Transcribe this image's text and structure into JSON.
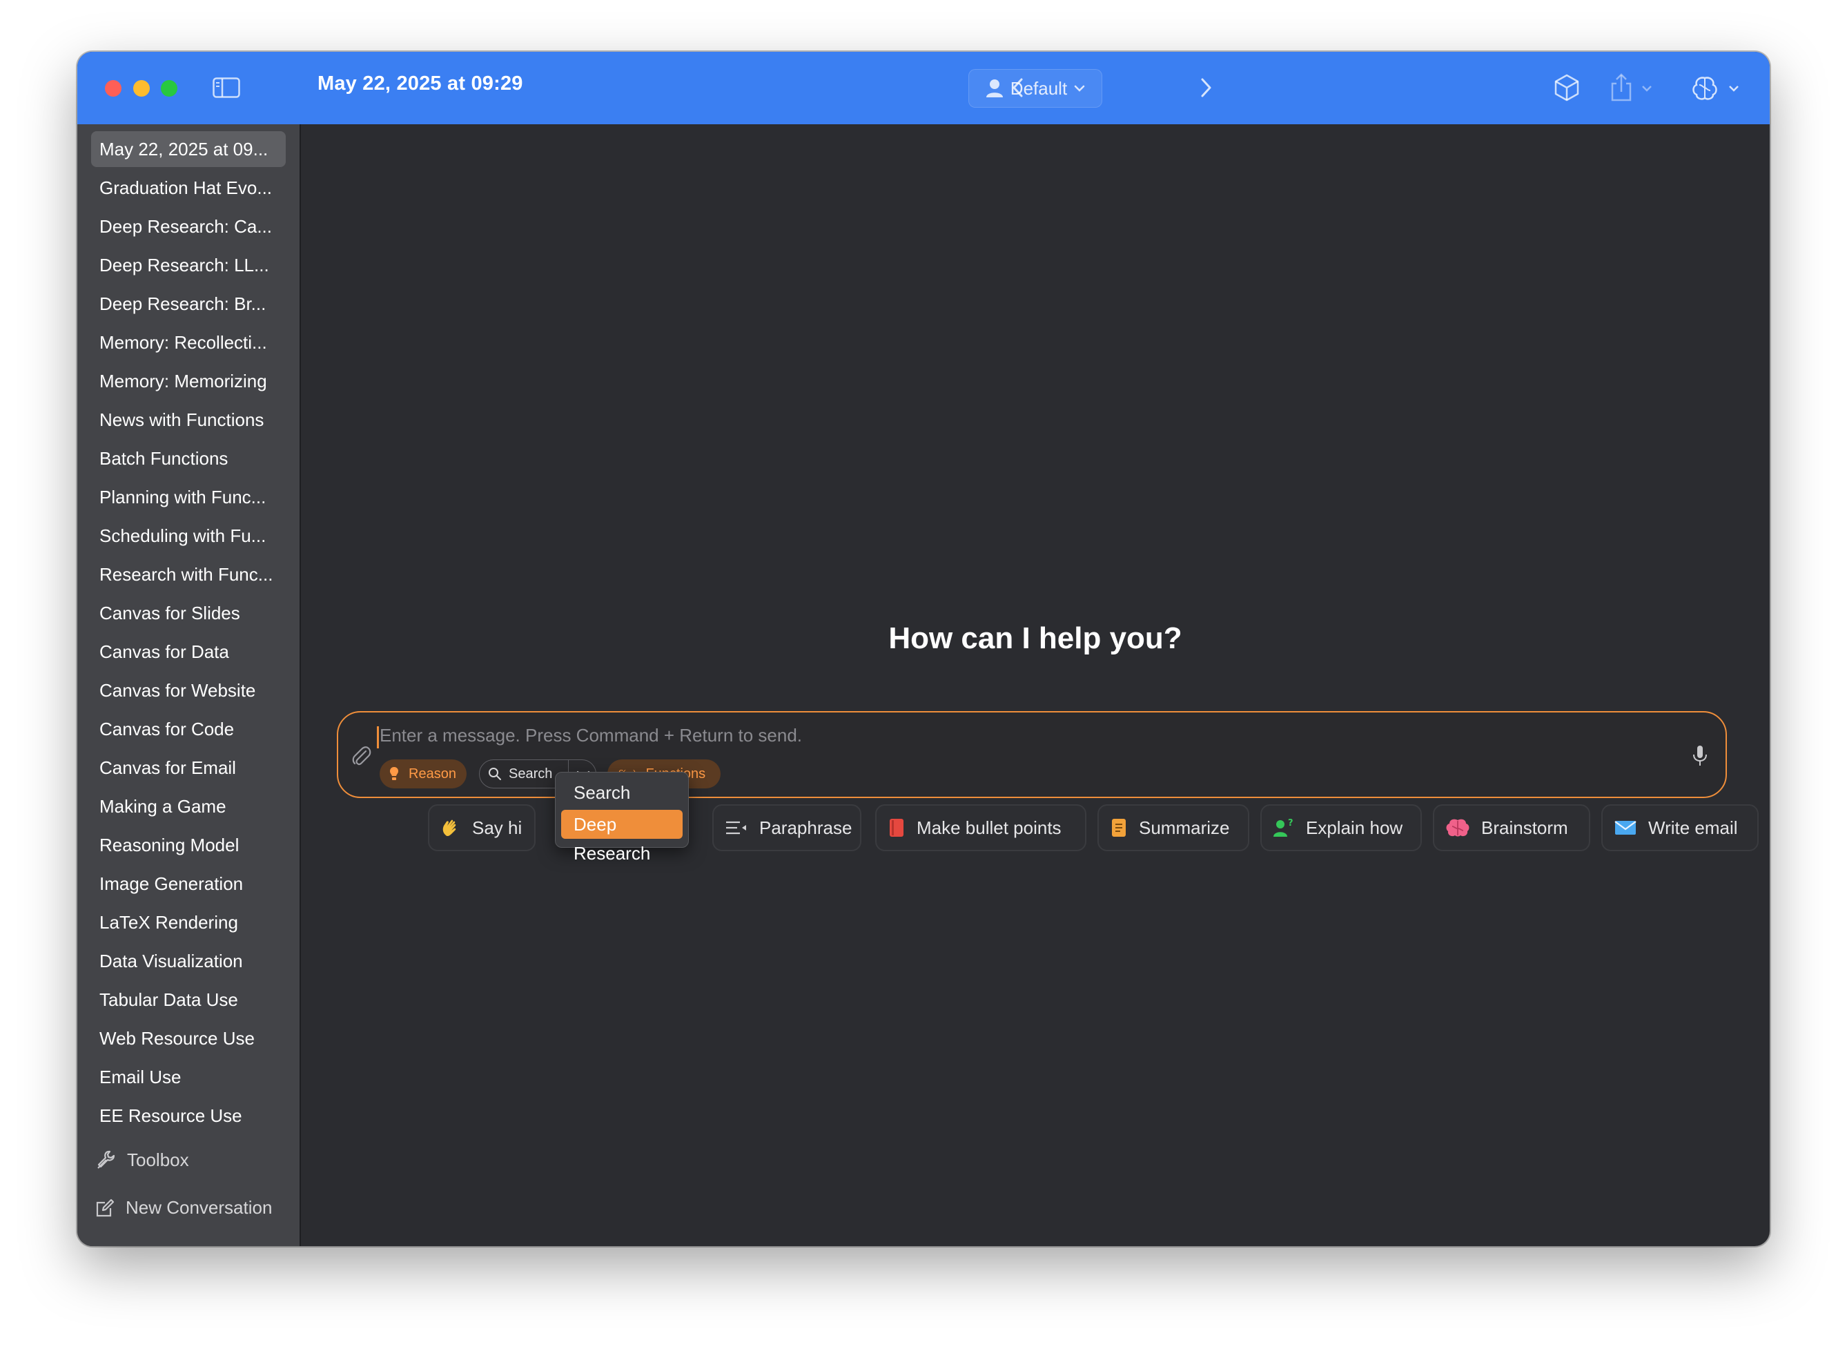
{
  "window": {
    "title": "May 22, 2025 at 09:29"
  },
  "toolbar": {
    "profile_label": "Default",
    "icons": [
      "sidebar-toggle-icon",
      "chevron-left-icon",
      "person-icon",
      "chevron-down-icon",
      "chevron-right-icon",
      "cube-icon",
      "share-icon",
      "brain-icon"
    ]
  },
  "sidebar": {
    "conversations": [
      "May 22, 2025 at 09...",
      "Graduation Hat Evo...",
      "Deep Research: Ca...",
      "Deep Research: LL...",
      "Deep Research: Br...",
      "Memory: Recollecti...",
      "Memory: Memorizing",
      "News with Functions",
      "Batch Functions",
      "Planning with Func...",
      "Scheduling with Fu...",
      "Research with Func...",
      "Canvas for Slides",
      "Canvas for Data",
      "Canvas for Website",
      "Canvas for Code",
      "Canvas for Email",
      "Making a Game",
      "Reasoning Model",
      "Image Generation",
      "LaTeX Rendering",
      "Data Visualization",
      "Tabular Data Use",
      "Web Resource Use",
      "Email Use",
      "EE Resource Use"
    ],
    "active_index": 0,
    "toolbox_label": "Toolbox",
    "new_conversation_label": "New Conversation"
  },
  "main": {
    "heading": "How can I help you?",
    "composer": {
      "placeholder": "Enter a message. Press Command + Return to send.",
      "reason_label": "Reason",
      "search_label": "Search",
      "functions_label": "Functions"
    },
    "search_menu": {
      "options": [
        "Search",
        "Deep Research"
      ],
      "selected_index": 1
    },
    "suggestions": [
      {
        "label": "Say hi",
        "icon": "waving-hand-icon"
      },
      {
        "label": "Paraphrase",
        "icon": "text-lines-icon"
      },
      {
        "label": "Make bullet points",
        "icon": "red-book-icon"
      },
      {
        "label": "Summarize",
        "icon": "orange-document-icon"
      },
      {
        "label": "Explain how",
        "icon": "person-question-icon"
      },
      {
        "label": "Brainstorm",
        "icon": "brain-icon"
      },
      {
        "label": "Write email",
        "icon": "envelope-icon"
      }
    ]
  },
  "colors": {
    "titlebar": "#3b7ff2",
    "accent": "#ef8e3a",
    "sidebar": "#434448",
    "content": "#2b2c30"
  }
}
